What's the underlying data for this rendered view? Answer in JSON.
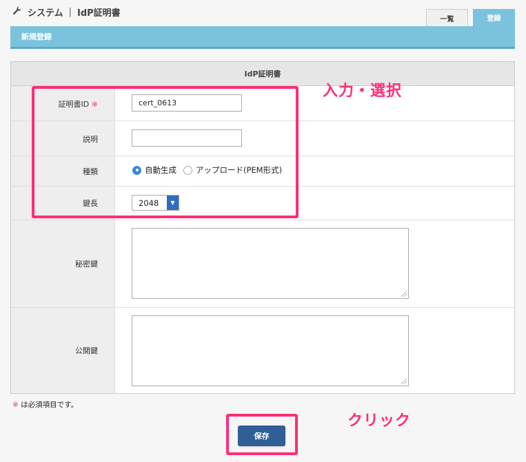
{
  "header": {
    "icon": "wrench-icon",
    "section": "システム",
    "separator": "|",
    "page": "IdP証明書"
  },
  "tabs": {
    "list": "一覧",
    "register": "登録"
  },
  "section_title": "新規登録",
  "table": {
    "heading": "IdP証明書",
    "fields": {
      "cert_id": {
        "label": "証明書ID",
        "required_mark": "※",
        "value": "cert_0613"
      },
      "description": {
        "label": "説明",
        "value": ""
      },
      "type": {
        "label": "種類",
        "options": [
          "自動生成",
          "アップロード(PEM形式)"
        ],
        "selected": "自動生成"
      },
      "key_length": {
        "label": "鍵長",
        "value": "2048"
      },
      "private_key": {
        "label": "秘密鍵",
        "value": ""
      },
      "public_key": {
        "label": "公開鍵",
        "value": ""
      }
    }
  },
  "footnote": {
    "mark": "※",
    "text": " は必須項目です。"
  },
  "save_label": "保存",
  "annotations": {
    "inputs": "入力・選択",
    "click": "クリック",
    "color": "#ff2d78"
  },
  "colors": {
    "accent": "#7bc3dd",
    "button": "#2f5f96",
    "required": "#e8385c"
  }
}
